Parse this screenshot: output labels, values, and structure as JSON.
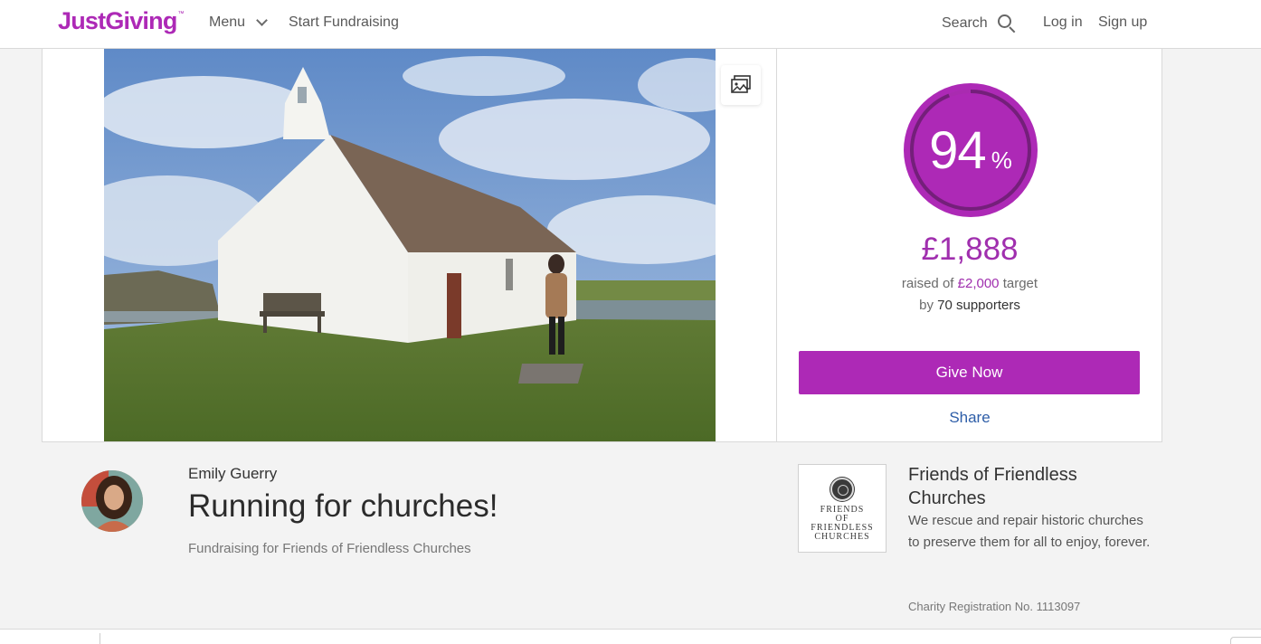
{
  "header": {
    "logo": "JustGiving",
    "logo_tm": "™",
    "menu_label": "Menu",
    "start_label": "Start Fundraising",
    "search_label": "Search",
    "login_label": "Log in",
    "signup_label": "Sign up"
  },
  "progress": {
    "percent": "94",
    "percent_sign": "%",
    "percent_value": 94,
    "raised": "£1,888",
    "raised_prefix": "raised of",
    "target": "£2,000",
    "target_suffix": "target",
    "by_prefix": "by",
    "supporters": "70 supporters",
    "give_label": "Give Now",
    "share_label": "Share"
  },
  "page": {
    "owner": "Emily Guerry",
    "title": "Running for churches!",
    "fundraising_for": "Fundraising for Friends of Friendless Churches"
  },
  "charity": {
    "logo_line1": "FRIENDS",
    "logo_line2": "OF",
    "logo_line3": "FRIENDLESS",
    "logo_line4": "CHURCHES",
    "name": "Friends of Friendless Churches",
    "description": "We rescue and repair historic churches to preserve them for all to enjoy, forever.",
    "registration": "Charity Registration No. 1113097"
  },
  "colors": {
    "brand": "#ad29b6",
    "link": "#2e5ea8"
  }
}
